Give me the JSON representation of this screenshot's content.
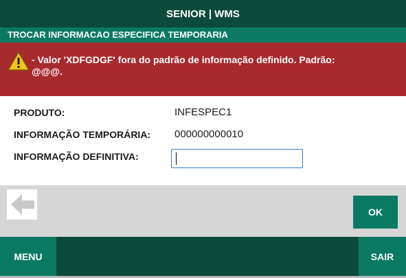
{
  "header": {
    "title": "SENIOR | WMS",
    "subtitle": "TROCAR INFORMACAO ESPECIFICA TEMPORARIA"
  },
  "error": {
    "icon": "warning-icon",
    "message_line1": "- Valor 'XDFGDGF' fora do padrão de informação definido. Padrão:",
    "message_line2": "@@@."
  },
  "form": {
    "produto_label": "PRODUTO:",
    "produto_value": "INFESPEC1",
    "info_temp_label": "INFORMAÇÃO TEMPORÁRIA:",
    "info_temp_value": "000000000010",
    "info_def_label": "INFORMAÇÃO DEFINITIVA:",
    "info_def_value": "",
    "info_def_placeholder": ""
  },
  "actions": {
    "back_icon": "arrow-left-icon",
    "ok_label": "OK"
  },
  "footer": {
    "menu_label": "MENU",
    "sair_label": "SAIR"
  },
  "colors": {
    "header_bg": "#0c4a3b",
    "accent": "#0b7a63",
    "error_bg": "#a72a2d",
    "action_bg": "#d6d6d6"
  }
}
